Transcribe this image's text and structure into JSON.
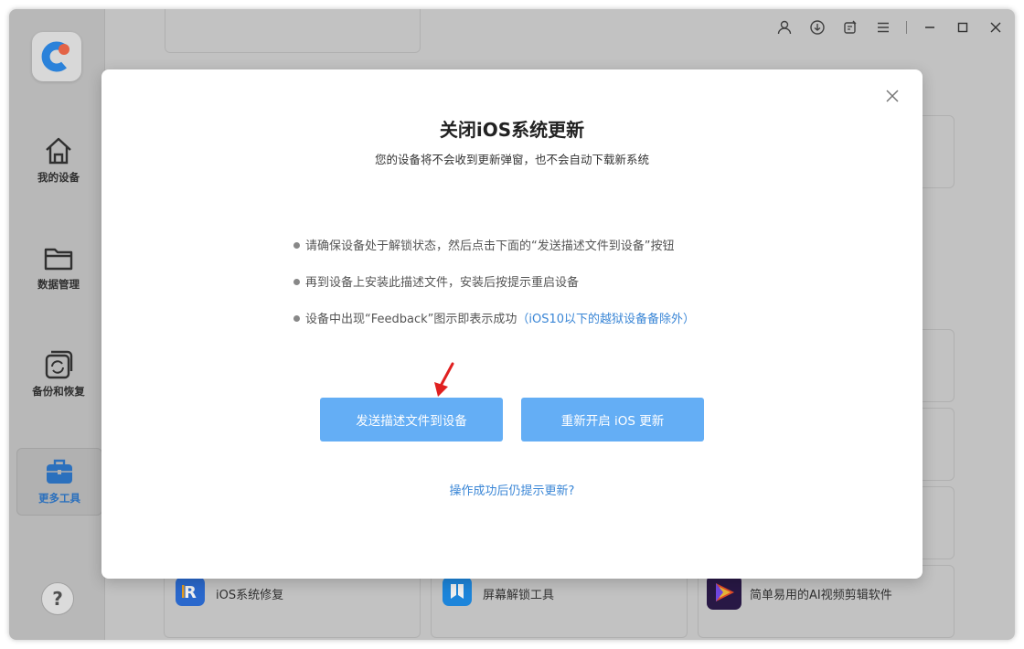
{
  "sidebar": {
    "items": [
      {
        "label": "我的设备",
        "icon": "home-icon"
      },
      {
        "label": "数据管理",
        "icon": "folder-icon"
      },
      {
        "label": "备份和恢复",
        "icon": "backup-restore-icon"
      },
      {
        "label": "更多工具",
        "icon": "toolbox-icon",
        "active": true
      }
    ],
    "help_label": "?"
  },
  "topbar": {
    "icons": [
      "user-icon",
      "download-icon",
      "feedback-icon",
      "menu-icon",
      "minimize-icon",
      "maximize-icon",
      "close-icon"
    ]
  },
  "background_cards": [
    {
      "title": "iOS系统修复",
      "icon": "ios-repair-icon"
    },
    {
      "title": "屏幕解锁工具",
      "icon": "screen-unlock-icon"
    },
    {
      "title": "简单易用的AI视频剪辑软件",
      "icon": "ai-video-icon"
    }
  ],
  "modal": {
    "title": "关闭iOS系统更新",
    "subtitle": "您的设备将不会收到更新弹窗，也不会自动下载新系统",
    "steps": [
      {
        "text": "请确保设备处于解锁状态，然后点击下面的“发送描述文件到设备”按钮",
        "highlight": ""
      },
      {
        "text": "再到设备上安装此描述文件，安装后按提示重启设备",
        "highlight": ""
      },
      {
        "text": "设备中出现“Feedback”图示即表示成功",
        "highlight": "（iOS10以下的越狱设备备除外）"
      }
    ],
    "send_button": "发送描述文件到设备",
    "reenable_button": "重新开启 iOS 更新",
    "help_link": "操作成功后仍提示更新?"
  },
  "colors": {
    "accent": "#64aef5",
    "link": "#3a86d6",
    "arrow": "#e02020"
  }
}
